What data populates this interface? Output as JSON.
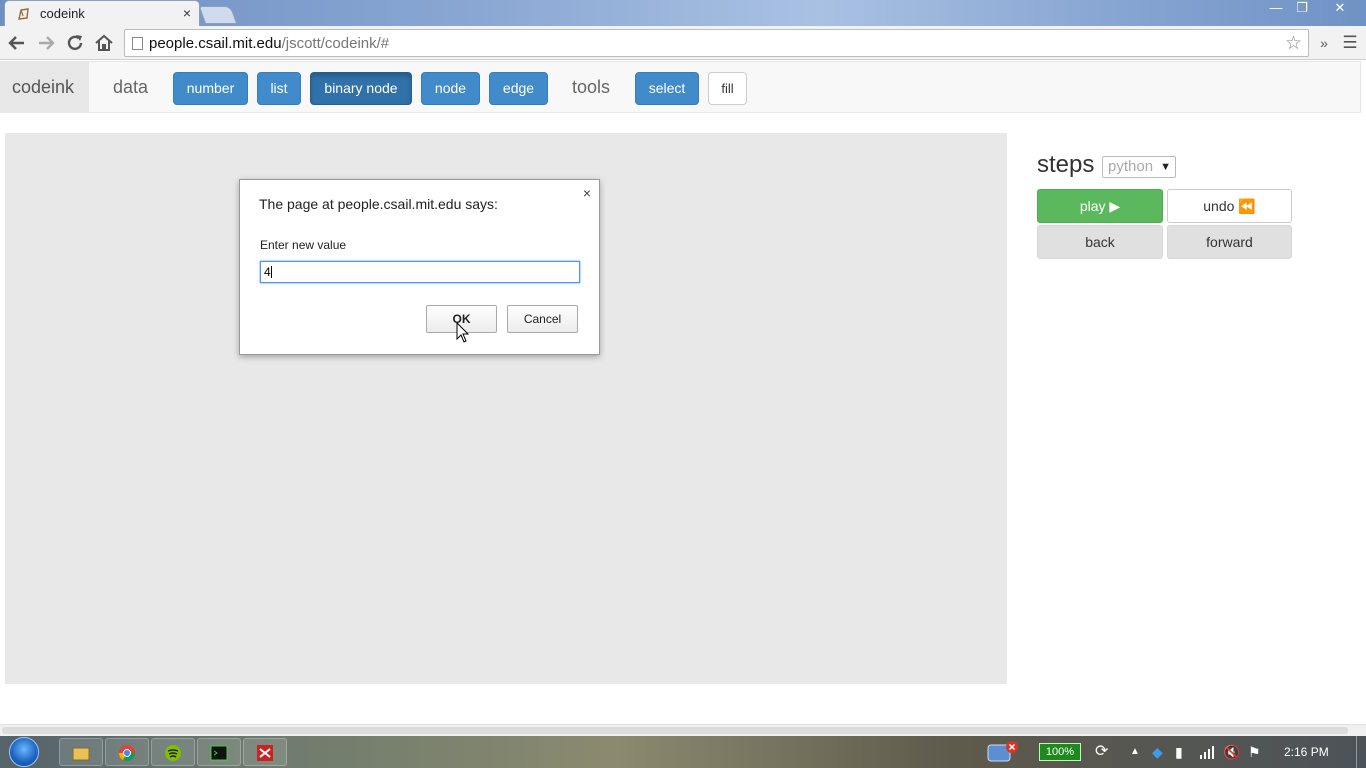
{
  "browser": {
    "tab_title": "codeink",
    "tab_close": "×",
    "url_host": "people.csail.mit.edu",
    "url_path": "/jscott/codeink/#",
    "more": "»",
    "menu": "☰",
    "minimize": "—",
    "restore": "❐",
    "close": "✕"
  },
  "navbar": {
    "brand": "codeink",
    "data_label": "data",
    "tools_label": "tools",
    "data_buttons": [
      "number",
      "list",
      "binary node",
      "node",
      "edge"
    ],
    "tool_buttons": [
      "select",
      "fill"
    ]
  },
  "steps": {
    "title": "steps",
    "language": "python",
    "play": "play ▶",
    "undo": "undo ⏪",
    "back": "back",
    "forward": "forward"
  },
  "dialog": {
    "title": "The page at people.csail.mit.edu says:",
    "message": "Enter new value",
    "value": "4",
    "ok": "OK",
    "cancel": "Cancel",
    "close": "×"
  },
  "taskbar": {
    "battery": "100%",
    "time": "2:16 PM"
  },
  "colors": {
    "primary": "#428bca",
    "success": "#5cb85c",
    "canvas": "#e8e8e8"
  }
}
